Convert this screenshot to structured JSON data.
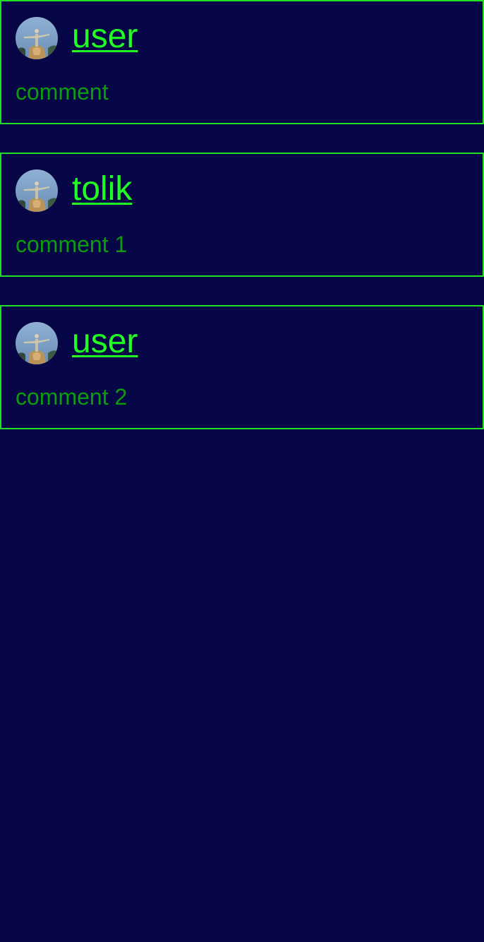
{
  "colors": {
    "background": "#070647",
    "border": "#1fe01f",
    "username": "#22ff22",
    "comment_text": "#0e9c0e"
  },
  "comments": [
    {
      "username": "user",
      "text": "comment",
      "avatar_icon": "statue-avatar-icon"
    },
    {
      "username": "tolik",
      "text": "comment 1",
      "avatar_icon": "statue-avatar-icon"
    },
    {
      "username": "user",
      "text": "comment 2",
      "avatar_icon": "statue-avatar-icon"
    }
  ]
}
